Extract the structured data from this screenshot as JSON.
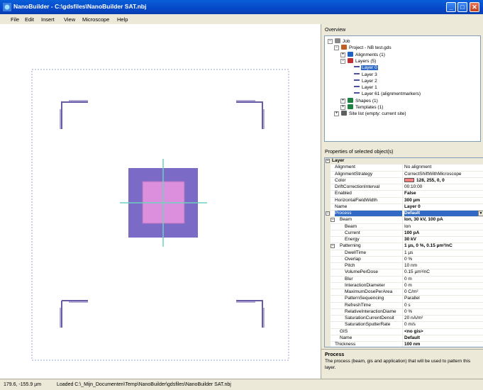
{
  "window": {
    "title": "NanoBuilder - C:\\gdsfiles\\NanoBuilder SAT.nbj",
    "app_icon": "nanobuilder-icon",
    "buttons": {
      "minimize": "_",
      "maximize": "□",
      "close": "✕"
    }
  },
  "menu": [
    "File",
    "Edit",
    "Insert",
    "View",
    "Microscope",
    "Help"
  ],
  "overview": {
    "label": "Overview",
    "tree": [
      {
        "label": "Job",
        "level": 0,
        "expander": "−",
        "icon": "job-icon"
      },
      {
        "label": "Project - NB test.gds",
        "level": 1,
        "expander": "−",
        "icon": "project-icon"
      },
      {
        "label": "Alignments (1)",
        "level": 2,
        "expander": "+",
        "icon": "alignments-icon"
      },
      {
        "label": "Layers (5)",
        "level": 2,
        "expander": "−",
        "icon": "layers-icon"
      },
      {
        "label": "Layer 0",
        "level": 3,
        "expander": "",
        "icon": "layer-icon",
        "selected": true
      },
      {
        "label": "Layer 3",
        "level": 3,
        "expander": "",
        "icon": "layer-icon"
      },
      {
        "label": "Layer 2",
        "level": 3,
        "expander": "",
        "icon": "layer-icon"
      },
      {
        "label": "Layer 1",
        "level": 3,
        "expander": "",
        "icon": "layer-icon"
      },
      {
        "label": "Layer 61 (alignmentmarkers)",
        "level": 3,
        "expander": "",
        "icon": "layer-icon"
      },
      {
        "label": "Shapes (1)",
        "level": 2,
        "expander": "+",
        "icon": "shapes-icon"
      },
      {
        "label": "Templates (1)",
        "level": 2,
        "expander": "+",
        "icon": "templates-icon"
      },
      {
        "label": "Site list (empty: current site)",
        "level": 1,
        "expander": "+",
        "icon": "sitelist-icon"
      }
    ]
  },
  "properties": {
    "label": "Properties of selected object(s)",
    "rows": [
      {
        "type": "cat",
        "name": "Layer",
        "expander": "⊟"
      },
      {
        "name": "Alignment",
        "value": "No alignment"
      },
      {
        "name": "AlignmentStrategy",
        "value": "CorrectShiftWithMicroscope"
      },
      {
        "name": "Color",
        "value": "128, 255, 0, 0",
        "swatch": "#ff8080",
        "bold": true
      },
      {
        "name": "DriftCorrectionInterval",
        "value": "00:10:00"
      },
      {
        "name": "Enabled",
        "value": "False",
        "bold": true
      },
      {
        "name": "HorizontalFieldWidth",
        "value": "300 µm",
        "bold": true
      },
      {
        "name": "Name",
        "value": "Layer 0",
        "bold": true
      },
      {
        "name": "Process",
        "value": "Default",
        "selected": true,
        "bold": true,
        "expander": "⊟"
      },
      {
        "name": "Beam",
        "value": "Ion, 30 kV, 100 pA",
        "indent": 1,
        "bold": true,
        "expander": "⊟"
      },
      {
        "name": "Beam",
        "value": "Ion",
        "indent": 2
      },
      {
        "name": "Current",
        "value": "100 pA",
        "indent": 2,
        "bold": true
      },
      {
        "name": "Energy",
        "value": "30 kV",
        "indent": 2,
        "bold": true
      },
      {
        "name": "Patterning",
        "value": "1 µs, 0 %, 0.15 µm³/nC",
        "indent": 1,
        "bold": true,
        "expander": "⊟"
      },
      {
        "name": "DwellTime",
        "value": "1 µs",
        "indent": 2
      },
      {
        "name": "Overlap",
        "value": "0 %",
        "indent": 2
      },
      {
        "name": "Pitch",
        "value": "10 nm",
        "indent": 2
      },
      {
        "name": "VolumePerDose",
        "value": "0.15 µm³/nC",
        "indent": 2
      },
      {
        "name": "Blur",
        "value": "0 m",
        "indent": 2
      },
      {
        "name": "InteractionDiameter",
        "value": "0 m",
        "indent": 2
      },
      {
        "name": "MaximumDosePerArea",
        "value": "0 C/m²",
        "indent": 2
      },
      {
        "name": "PatternSequencing",
        "value": "Parallel",
        "indent": 2
      },
      {
        "name": "RefreshTime",
        "value": "0 s",
        "indent": 2
      },
      {
        "name": "RelativeInteractionDiame",
        "value": "0 %",
        "indent": 2
      },
      {
        "name": "SaturationCurrentDensit",
        "value": "20 nA/m²",
        "indent": 2
      },
      {
        "name": "SaturationSputterRate",
        "value": "0 m/s",
        "indent": 2
      },
      {
        "name": "GIS",
        "value": "<no gis>",
        "indent": 1,
        "bold": true
      },
      {
        "name": "Name",
        "value": "Default",
        "indent": 1,
        "bold": true
      },
      {
        "name": "Thickness",
        "value": "100 nm",
        "bold": true
      }
    ]
  },
  "description": {
    "title": "Process",
    "text": "The process (beam, gis and application) that will be used to pattern this layer."
  },
  "status": {
    "coords": "179.6, -155.9 µm",
    "message": "Loaded C:\\_Mijn_Documenten\\Temp\\NanoBuilder\\gdsfiles\\NanoBuilder SAT.nbj"
  },
  "colors": {
    "outer_square": "#7b6bc7",
    "inner_square": "#dc8fdd",
    "crosshair": "#6fd0c0",
    "corner_marks": "#6a5aa8",
    "field_border": "#9aa6d6",
    "selection": "#316ac5"
  }
}
